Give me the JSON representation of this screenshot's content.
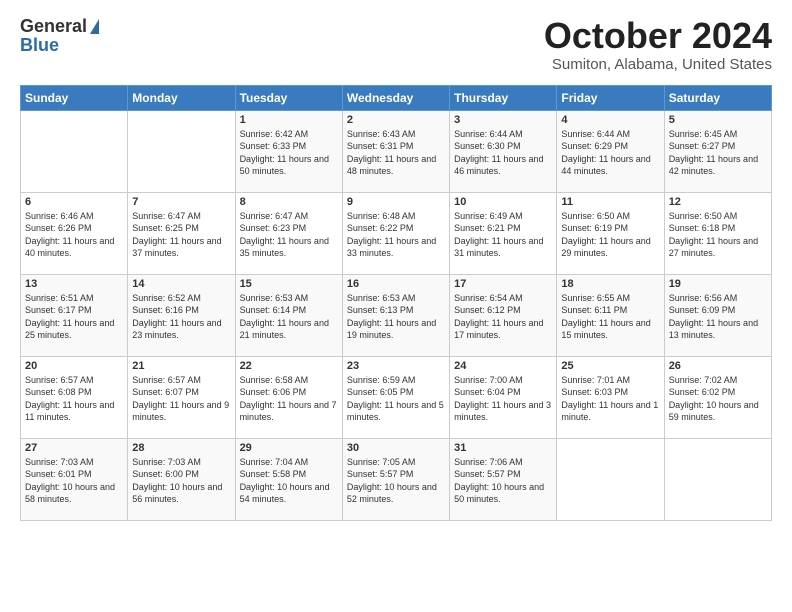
{
  "header": {
    "logo_general": "General",
    "logo_blue": "Blue",
    "month_title": "October 2024",
    "location": "Sumiton, Alabama, United States"
  },
  "days_of_week": [
    "Sunday",
    "Monday",
    "Tuesday",
    "Wednesday",
    "Thursday",
    "Friday",
    "Saturday"
  ],
  "weeks": [
    [
      {
        "day": "",
        "sunrise": "",
        "sunset": "",
        "daylight": ""
      },
      {
        "day": "",
        "sunrise": "",
        "sunset": "",
        "daylight": ""
      },
      {
        "day": "1",
        "sunrise": "Sunrise: 6:42 AM",
        "sunset": "Sunset: 6:33 PM",
        "daylight": "Daylight: 11 hours and 50 minutes."
      },
      {
        "day": "2",
        "sunrise": "Sunrise: 6:43 AM",
        "sunset": "Sunset: 6:31 PM",
        "daylight": "Daylight: 11 hours and 48 minutes."
      },
      {
        "day": "3",
        "sunrise": "Sunrise: 6:44 AM",
        "sunset": "Sunset: 6:30 PM",
        "daylight": "Daylight: 11 hours and 46 minutes."
      },
      {
        "day": "4",
        "sunrise": "Sunrise: 6:44 AM",
        "sunset": "Sunset: 6:29 PM",
        "daylight": "Daylight: 11 hours and 44 minutes."
      },
      {
        "day": "5",
        "sunrise": "Sunrise: 6:45 AM",
        "sunset": "Sunset: 6:27 PM",
        "daylight": "Daylight: 11 hours and 42 minutes."
      }
    ],
    [
      {
        "day": "6",
        "sunrise": "Sunrise: 6:46 AM",
        "sunset": "Sunset: 6:26 PM",
        "daylight": "Daylight: 11 hours and 40 minutes."
      },
      {
        "day": "7",
        "sunrise": "Sunrise: 6:47 AM",
        "sunset": "Sunset: 6:25 PM",
        "daylight": "Daylight: 11 hours and 37 minutes."
      },
      {
        "day": "8",
        "sunrise": "Sunrise: 6:47 AM",
        "sunset": "Sunset: 6:23 PM",
        "daylight": "Daylight: 11 hours and 35 minutes."
      },
      {
        "day": "9",
        "sunrise": "Sunrise: 6:48 AM",
        "sunset": "Sunset: 6:22 PM",
        "daylight": "Daylight: 11 hours and 33 minutes."
      },
      {
        "day": "10",
        "sunrise": "Sunrise: 6:49 AM",
        "sunset": "Sunset: 6:21 PM",
        "daylight": "Daylight: 11 hours and 31 minutes."
      },
      {
        "day": "11",
        "sunrise": "Sunrise: 6:50 AM",
        "sunset": "Sunset: 6:19 PM",
        "daylight": "Daylight: 11 hours and 29 minutes."
      },
      {
        "day": "12",
        "sunrise": "Sunrise: 6:50 AM",
        "sunset": "Sunset: 6:18 PM",
        "daylight": "Daylight: 11 hours and 27 minutes."
      }
    ],
    [
      {
        "day": "13",
        "sunrise": "Sunrise: 6:51 AM",
        "sunset": "Sunset: 6:17 PM",
        "daylight": "Daylight: 11 hours and 25 minutes."
      },
      {
        "day": "14",
        "sunrise": "Sunrise: 6:52 AM",
        "sunset": "Sunset: 6:16 PM",
        "daylight": "Daylight: 11 hours and 23 minutes."
      },
      {
        "day": "15",
        "sunrise": "Sunrise: 6:53 AM",
        "sunset": "Sunset: 6:14 PM",
        "daylight": "Daylight: 11 hours and 21 minutes."
      },
      {
        "day": "16",
        "sunrise": "Sunrise: 6:53 AM",
        "sunset": "Sunset: 6:13 PM",
        "daylight": "Daylight: 11 hours and 19 minutes."
      },
      {
        "day": "17",
        "sunrise": "Sunrise: 6:54 AM",
        "sunset": "Sunset: 6:12 PM",
        "daylight": "Daylight: 11 hours and 17 minutes."
      },
      {
        "day": "18",
        "sunrise": "Sunrise: 6:55 AM",
        "sunset": "Sunset: 6:11 PM",
        "daylight": "Daylight: 11 hours and 15 minutes."
      },
      {
        "day": "19",
        "sunrise": "Sunrise: 6:56 AM",
        "sunset": "Sunset: 6:09 PM",
        "daylight": "Daylight: 11 hours and 13 minutes."
      }
    ],
    [
      {
        "day": "20",
        "sunrise": "Sunrise: 6:57 AM",
        "sunset": "Sunset: 6:08 PM",
        "daylight": "Daylight: 11 hours and 11 minutes."
      },
      {
        "day": "21",
        "sunrise": "Sunrise: 6:57 AM",
        "sunset": "Sunset: 6:07 PM",
        "daylight": "Daylight: 11 hours and 9 minutes."
      },
      {
        "day": "22",
        "sunrise": "Sunrise: 6:58 AM",
        "sunset": "Sunset: 6:06 PM",
        "daylight": "Daylight: 11 hours and 7 minutes."
      },
      {
        "day": "23",
        "sunrise": "Sunrise: 6:59 AM",
        "sunset": "Sunset: 6:05 PM",
        "daylight": "Daylight: 11 hours and 5 minutes."
      },
      {
        "day": "24",
        "sunrise": "Sunrise: 7:00 AM",
        "sunset": "Sunset: 6:04 PM",
        "daylight": "Daylight: 11 hours and 3 minutes."
      },
      {
        "day": "25",
        "sunrise": "Sunrise: 7:01 AM",
        "sunset": "Sunset: 6:03 PM",
        "daylight": "Daylight: 11 hours and 1 minute."
      },
      {
        "day": "26",
        "sunrise": "Sunrise: 7:02 AM",
        "sunset": "Sunset: 6:02 PM",
        "daylight": "Daylight: 10 hours and 59 minutes."
      }
    ],
    [
      {
        "day": "27",
        "sunrise": "Sunrise: 7:03 AM",
        "sunset": "Sunset: 6:01 PM",
        "daylight": "Daylight: 10 hours and 58 minutes."
      },
      {
        "day": "28",
        "sunrise": "Sunrise: 7:03 AM",
        "sunset": "Sunset: 6:00 PM",
        "daylight": "Daylight: 10 hours and 56 minutes."
      },
      {
        "day": "29",
        "sunrise": "Sunrise: 7:04 AM",
        "sunset": "Sunset: 5:58 PM",
        "daylight": "Daylight: 10 hours and 54 minutes."
      },
      {
        "day": "30",
        "sunrise": "Sunrise: 7:05 AM",
        "sunset": "Sunset: 5:57 PM",
        "daylight": "Daylight: 10 hours and 52 minutes."
      },
      {
        "day": "31",
        "sunrise": "Sunrise: 7:06 AM",
        "sunset": "Sunset: 5:57 PM",
        "daylight": "Daylight: 10 hours and 50 minutes."
      },
      {
        "day": "",
        "sunrise": "",
        "sunset": "",
        "daylight": ""
      },
      {
        "day": "",
        "sunrise": "",
        "sunset": "",
        "daylight": ""
      }
    ]
  ]
}
